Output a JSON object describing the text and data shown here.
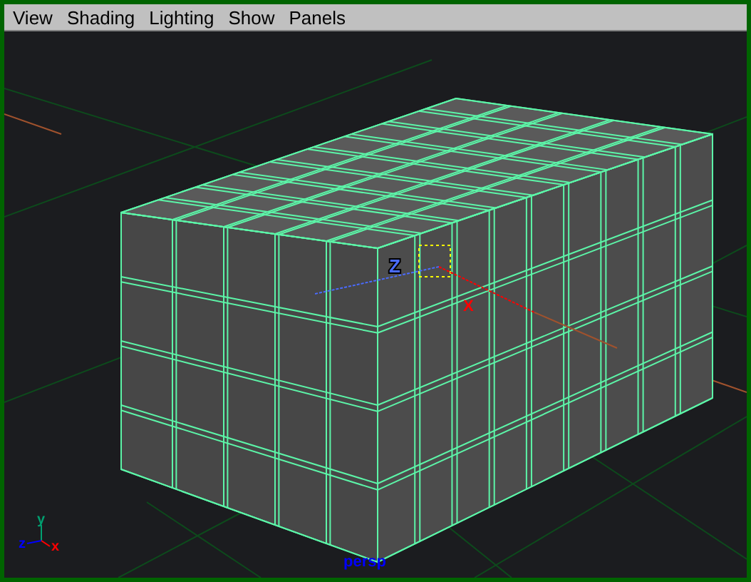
{
  "menu": [
    {
      "label": "View"
    },
    {
      "label": "Shading"
    },
    {
      "label": "Lighting"
    },
    {
      "label": "Show"
    },
    {
      "label": "Panels"
    }
  ],
  "viewport": {
    "camera_label": "persp",
    "manipulator_axes": [
      {
        "label": "Z",
        "color": "#4a6bff"
      },
      {
        "label": "X",
        "color": "#ff0000"
      }
    ],
    "view_axes": [
      {
        "label": "y",
        "color": "#00a070"
      },
      {
        "label": "z",
        "color": "#0000ff"
      },
      {
        "label": "x",
        "color": "#ff0000"
      }
    ]
  }
}
